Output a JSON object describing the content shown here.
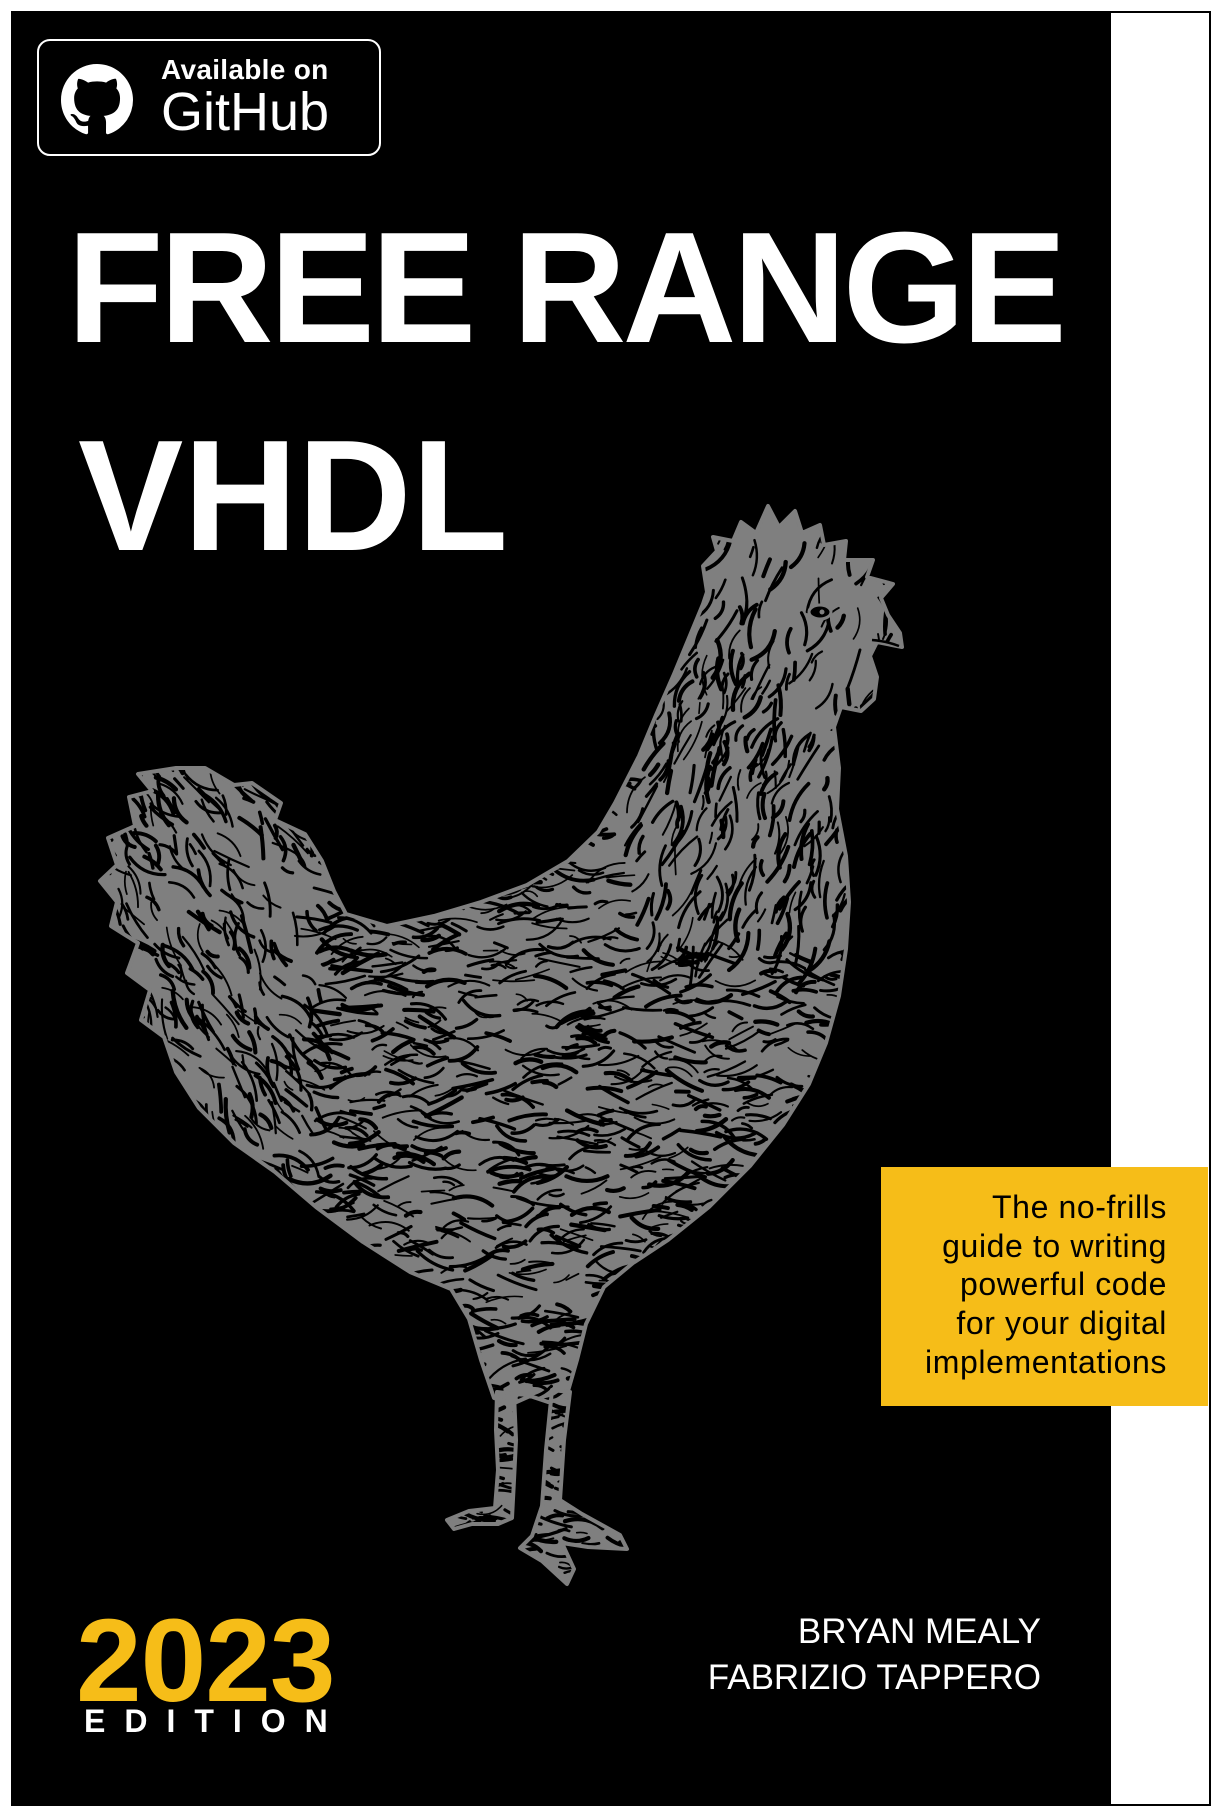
{
  "badge": {
    "icon": "github-icon",
    "line1": "Available on",
    "line2": "GitHub"
  },
  "title": {
    "line1": "FREE RANGE",
    "line2": "VHDL"
  },
  "icons": {
    "badge": "github-icon",
    "cover_art": "rooster-illustration"
  },
  "tagline": {
    "lines": [
      "The no-frills",
      "guide to writing",
      "powerful code",
      "for your digital",
      "implementations"
    ]
  },
  "edition": {
    "year": "2023",
    "label": "EDITION"
  },
  "authors": [
    "BRYAN MEALY",
    "FABRIZIO TAPPERO"
  ],
  "colors": {
    "page": "#ffffff",
    "cover": "#000000",
    "text": "#ffffff",
    "accent": "#f6bd18",
    "illustration": "#7f7f7f"
  }
}
